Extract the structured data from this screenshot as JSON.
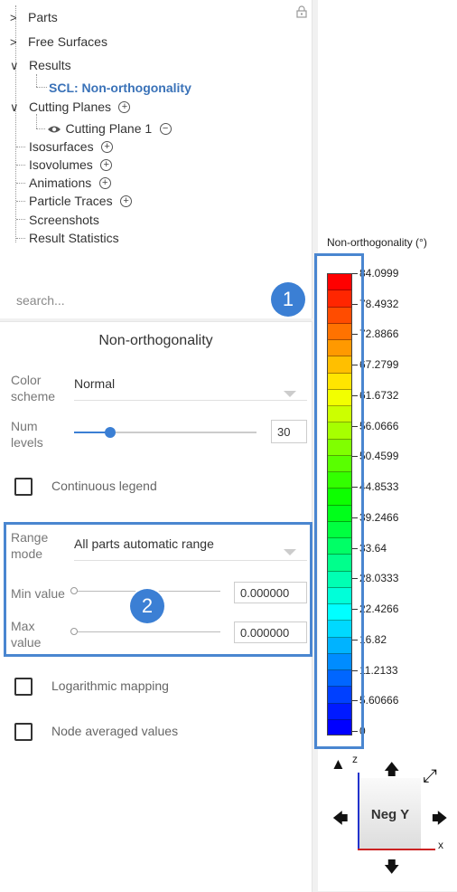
{
  "tree": {
    "items": [
      {
        "label": "Parts"
      },
      {
        "label": "Free Surfaces"
      },
      {
        "label": "Results"
      },
      {
        "label": "SCL: Non-orthogonality"
      },
      {
        "label": "Cutting Planes"
      },
      {
        "label": "Cutting Plane 1"
      },
      {
        "label": "Isosurfaces"
      },
      {
        "label": "Isovolumes"
      },
      {
        "label": "Animations"
      },
      {
        "label": "Particle Traces"
      },
      {
        "label": "Screenshots"
      },
      {
        "label": "Result Statistics"
      }
    ],
    "search_placeholder": "search..."
  },
  "settings": {
    "title": "Non-orthogonality",
    "color_scheme_label": "Color scheme",
    "color_scheme_value": "Normal",
    "num_levels_label": "Num levels",
    "num_levels_value": "30",
    "num_levels_fraction": 0.2,
    "continuous_legend_label": "Continuous legend",
    "range_mode_label": "Range mode",
    "range_mode_value": "All parts automatic range",
    "min_value_label": "Min value",
    "min_value": "0.000000",
    "max_value_label": "Max value",
    "max_value": "0.000000",
    "logarithmic_label": "Logarithmic mapping",
    "node_averaged_label": "Node averaged values"
  },
  "annotations": {
    "badge1": "1",
    "badge2": "2",
    "accent": "#3b7fd4"
  },
  "legend": {
    "title": "Non-orthogonality (°)",
    "tick_labels": [
      "84.0999",
      "78.4932",
      "72.8866",
      "67.2799",
      "61.6732",
      "56.0666",
      "50.4599",
      "44.8533",
      "39.2466",
      "33.64",
      "28.0333",
      "22.4266",
      "16.82",
      "11.2133",
      "5.60666",
      "0"
    ],
    "colors": [
      "#ff0000",
      "#ff2600",
      "#ff4c00",
      "#ff7200",
      "#ff9900",
      "#ffbf00",
      "#ffe500",
      "#f2ff00",
      "#ccff00",
      "#a6ff00",
      "#80ff00",
      "#59ff00",
      "#33ff00",
      "#0dff00",
      "#00ff1a",
      "#00ff40",
      "#00ff66",
      "#00ff8c",
      "#00ffb3",
      "#00ffd9",
      "#00ffff",
      "#00d9ff",
      "#00b3ff",
      "#008cff",
      "#0066ff",
      "#0040ff",
      "#001aff",
      "#0000ff"
    ]
  },
  "view_cube": {
    "label": "Neg Y",
    "axis_z": "z",
    "axis_x": "x",
    "icons": [
      "up-arrow-icon",
      "down-arrow-icon",
      "left-arrow-icon",
      "right-arrow-icon",
      "rotate-icon",
      "fit-view-icon",
      "home-view-icon"
    ]
  },
  "lock_icon": "lock-icon"
}
